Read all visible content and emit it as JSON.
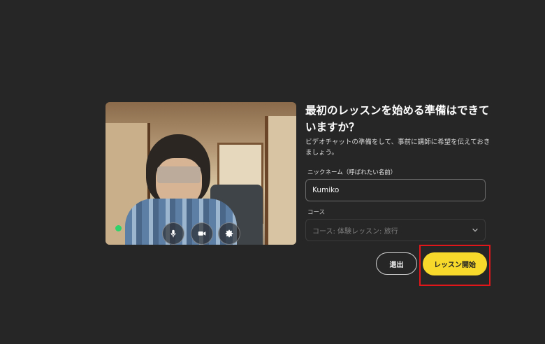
{
  "video": {
    "controls": [
      {
        "icon": "microphone-icon"
      },
      {
        "icon": "video-camera-icon"
      },
      {
        "icon": "gear-icon"
      }
    ],
    "status_color": "#2fd36b"
  },
  "form": {
    "heading": "最初のレッスンを始める準備はできていますか？",
    "subtitle": "ビデオチャットの準備をして、事前に講師に希望を伝えておきましょう。",
    "nickname_label": "ニックネーム（呼ばれたい名前）",
    "nickname_value": "Kumiko",
    "course_label": "コース",
    "course_value": "コース: 体験レッスン: 旅行"
  },
  "buttons": {
    "exit_label": "退出",
    "start_label": "レッスン開始"
  },
  "colors": {
    "background": "#262626",
    "accent": "#f7d92b",
    "highlight": "#e0161b"
  }
}
